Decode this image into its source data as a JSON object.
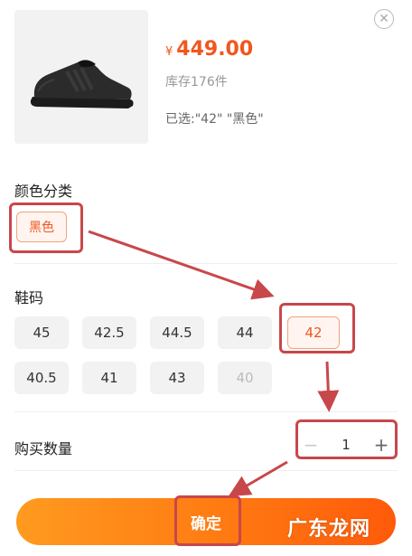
{
  "product": {
    "currency_symbol": "¥",
    "price": "449.00",
    "stock": "库存176件",
    "selected": "已选:\"42\" \"黑色\""
  },
  "color": {
    "title": "颜色分类",
    "options": [
      "黑色"
    ],
    "selected": "黑色"
  },
  "size": {
    "title": "鞋码",
    "options": [
      "45",
      "42.5",
      "44.5",
      "44",
      "42",
      "40.5",
      "41",
      "43",
      "40"
    ],
    "selected": "42",
    "disabled": [
      "40"
    ]
  },
  "quantity": {
    "title": "购买数量",
    "value": "1",
    "minus": "−",
    "plus": "+"
  },
  "confirm_label": "确定",
  "watermark": "广东龙网",
  "colors": {
    "accent": "#f2561d",
    "highlight_box": "#c8474b",
    "button_start": "#ff9a1f",
    "button_end": "#ff5a0a"
  }
}
